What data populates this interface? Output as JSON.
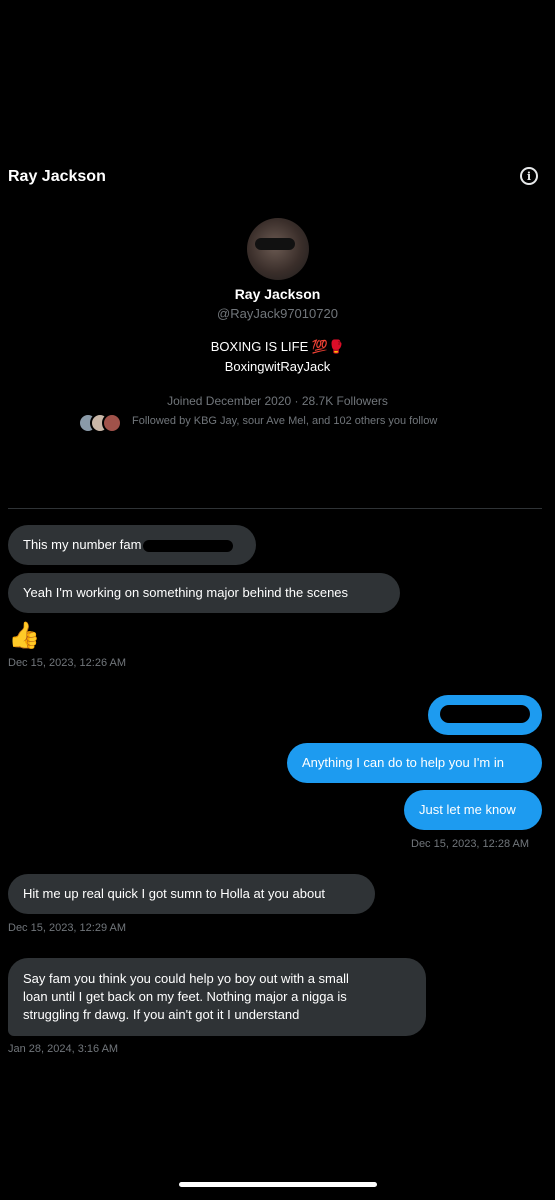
{
  "header": {
    "title": "Ray Jackson",
    "info_icon": "info-icon"
  },
  "profile": {
    "name": "Ray Jackson",
    "handle": "@RayJack97010720",
    "bio_line1": "BOXING IS LIFE 💯🥊",
    "bio_line2": "BoxingwitRayJack",
    "joined": "Joined December 2020 · 28.7K Followers",
    "followed_by": "Followed by KBG Jay, sour Ave Mel, and 102 others you follow"
  },
  "messages": {
    "m1": "This my number fam",
    "m2": "Yeah I'm working on something major behind the scenes",
    "m3_emoji": "👍",
    "ts1": "Dec 15, 2023, 12:26 AM",
    "m5": "Anything I can do to help you I'm in",
    "m6": "Just let me know",
    "ts2": "Dec 15, 2023, 12:28 AM",
    "m7": "Hit me up real quick I got sumn to Holla at you about",
    "ts3": "Dec 15, 2023, 12:29 AM",
    "m8_line1": "Say fam you think you could help yo boy out with a small",
    "m8_line2": "loan until I get back on my feet. Nothing major a nigga is",
    "m8_line3": "struggling fr dawg. If you ain't got it I understand",
    "ts4": "Jan 28, 2024, 3:16 AM"
  },
  "colors": {
    "sent_bubble": "#1d9bf0",
    "received_bubble": "#2f3336",
    "background": "#000000",
    "muted": "#71767b"
  }
}
